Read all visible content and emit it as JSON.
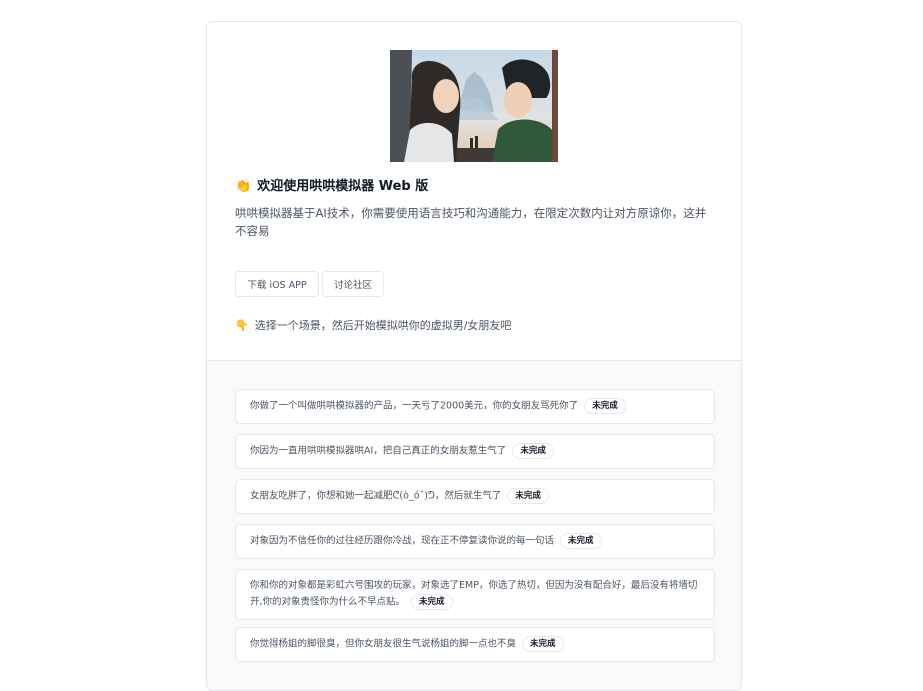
{
  "header": {
    "title_emoji": "👏",
    "title": "欢迎使用哄哄模拟器 Web 版",
    "description": "哄哄模拟器基于AI技术，你需要使用语言技巧和沟通能力，在限定次数内让对方原谅你，这并不容易",
    "buttons": {
      "ios": "下载 iOS APP",
      "community": "讨论社区"
    },
    "hint_emoji": "👇",
    "hint": "选择一个场景，然后开始模拟哄你的虚拟男/女朋友吧"
  },
  "scenes": [
    {
      "text": "你做了一个叫做哄哄模拟器的产品，一天亏了2000美元，你的女朋友骂死你了",
      "status": "未完成"
    },
    {
      "text": "你因为一直用哄哄模拟器哄AI，把自己真正的女朋友惹生气了",
      "status": "未完成"
    },
    {
      "text": "女朋友吃胖了，你想和她一起减肥ᕦ(ò_óˇ)ᕤ，然后就生气了",
      "status": "未完成"
    },
    {
      "text": "对象因为不信任你的过往经历跟你冷战，现在正不停复读你说的每一句话",
      "status": "未完成"
    },
    {
      "text": "你和你的对象都是彩虹六号围攻的玩家，对象选了EMP，你选了热切，但因为没有配合好，最后没有将墙切开,你的对象责怪你为什么不早点贴。",
      "status": "未完成"
    },
    {
      "text": "你觉得杨姐的脚很臭，但你女朋友很生气说杨姐的脚一点也不臭",
      "status": "未完成"
    }
  ]
}
